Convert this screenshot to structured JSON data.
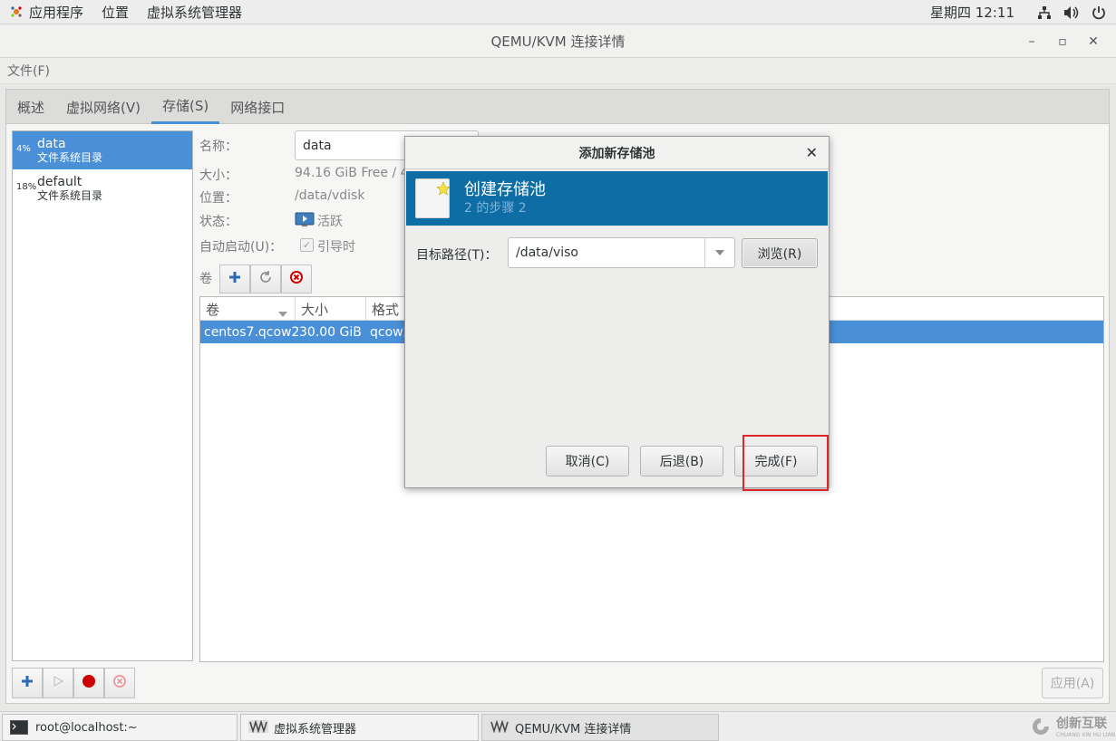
{
  "top_panel": {
    "applications": "应用程序",
    "places": "位置",
    "app_name": "虚拟系统管理器",
    "clock": "星期四 12:11",
    "icons": [
      "network-icon",
      "volume-icon",
      "power-icon"
    ]
  },
  "window": {
    "title": "QEMU/KVM 连接详情"
  },
  "menubar": {
    "file": "文件(F)"
  },
  "tabs": [
    {
      "label": "概述"
    },
    {
      "label": "虚拟网络(V)"
    },
    {
      "label": "存储(S)",
      "active": true
    },
    {
      "label": "网络接口"
    }
  ],
  "pools": [
    {
      "pct": "4%",
      "name": "data",
      "type": "文件系统目录",
      "selected": true
    },
    {
      "pct": "18%",
      "name": "default",
      "type": "文件系统目录",
      "selected": false
    }
  ],
  "details": {
    "name_label": "名称：",
    "name_value": "data",
    "size_label": "大小：",
    "size_value": "94.16 GiB Free / 4.",
    "location_label": "位置：",
    "location_value": "/data/vdisk",
    "state_label": "状态：",
    "state_value": "活跃",
    "autostart_label": "自动启动(U)：",
    "autostart_value": "引导时",
    "volumes_label": "卷"
  },
  "volume_table": {
    "headers": [
      "卷",
      "大小",
      "格式"
    ],
    "rows": [
      {
        "name": "centos7.qcow2",
        "size": "30.00 GiB",
        "format": "qcow2"
      }
    ]
  },
  "apply_button": "应用(A)",
  "dialog": {
    "title": "添加新存储池",
    "banner_title": "创建存储池",
    "banner_step": "2 的步骤 2",
    "target_label": "目标路径(T)：",
    "target_value": "/data/viso",
    "browse": "浏览(R)",
    "cancel": "取消(C)",
    "back": "后退(B)",
    "finish": "完成(F)"
  },
  "taskbar": [
    {
      "label": "root@localhost:~"
    },
    {
      "label": "虚拟系统管理器"
    },
    {
      "label": "QEMU/KVM 连接详情"
    }
  ],
  "watermark": {
    "text": "创新互联",
    "sub": "CHUANG XIN HU LIAN"
  },
  "colors": {
    "accent": "#4a90d9",
    "banner": "#0e6da5",
    "highlight": "#e0262b"
  }
}
